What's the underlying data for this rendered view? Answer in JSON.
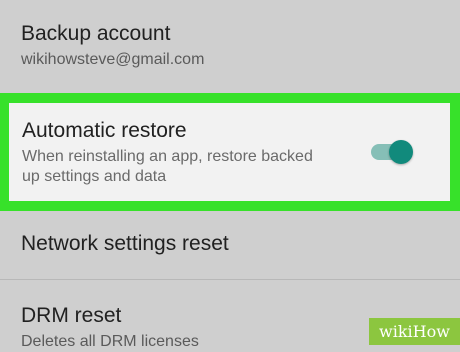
{
  "settings": {
    "backup": {
      "title": "Backup account",
      "subtitle": "wikihowsteve@gmail.com"
    },
    "restore": {
      "title": "Automatic restore",
      "subtitle": "When reinstalling an app, restore backed up settings and data",
      "toggle_on": true
    },
    "network": {
      "title": "Network settings reset"
    },
    "drm": {
      "title": "DRM reset",
      "subtitle": "Deletes all DRM licenses"
    }
  },
  "watermark": {
    "text": "wikiHow"
  },
  "colors": {
    "highlight": "#37e12a",
    "toggle_thumb": "#118a7c",
    "toggle_track": "#86bfb7",
    "watermark_bg": "#8cc63f"
  }
}
